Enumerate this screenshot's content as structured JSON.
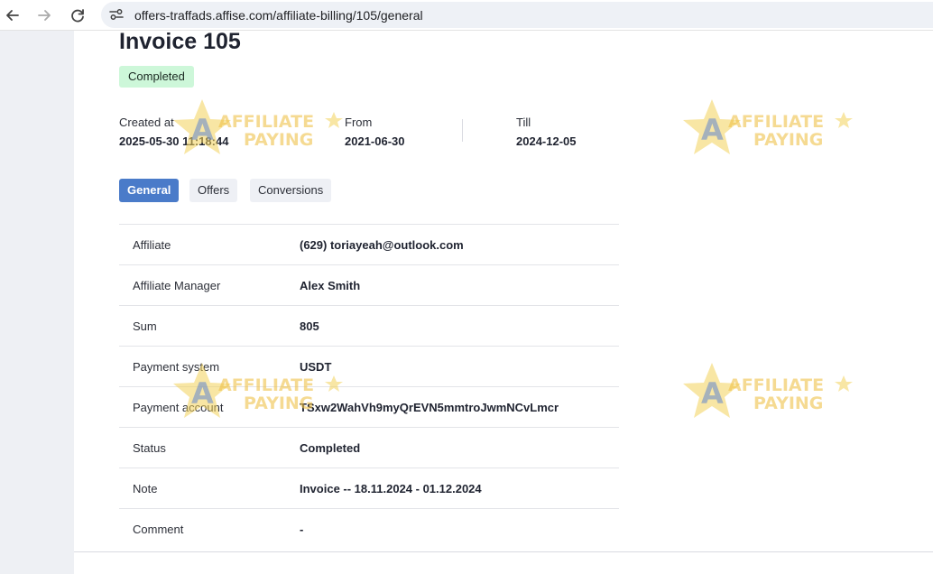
{
  "browser": {
    "url": "offers-traffads.affise.com/affiliate-billing/105/general"
  },
  "invoice": {
    "title": "Invoice 105",
    "status_badge": "Completed",
    "meta": [
      {
        "label": "Created at",
        "value": "2025-05-30 11:18:44"
      },
      {
        "label": "From",
        "value": "2021-06-30"
      },
      {
        "label": "Till",
        "value": "2024-12-05"
      }
    ]
  },
  "tabs": [
    {
      "label": "General",
      "active": true
    },
    {
      "label": "Offers",
      "active": false
    },
    {
      "label": "Conversions",
      "active": false
    }
  ],
  "details": [
    {
      "label": "Affiliate",
      "value": "(629) toriayeah@outlook.com"
    },
    {
      "label": "Affiliate Manager",
      "value": "Alex Smith"
    },
    {
      "label": "Sum",
      "value": "805"
    },
    {
      "label": "Payment system",
      "value": "USDT"
    },
    {
      "label": "Payment account",
      "value": "TSxw2WahVh9myQrEVN5mmtroJwmNCvLmcr"
    },
    {
      "label": "Status",
      "value": "Completed"
    },
    {
      "label": "Note",
      "value": "Invoice -- 18.11.2024 - 01.12.2024"
    },
    {
      "label": "Comment",
      "value": "-"
    }
  ],
  "watermark": {
    "line1": "AFFILIATE",
    "line2": "PAYING",
    "colors": {
      "star": "#f2d25a",
      "letter_a": "#6f8fcb",
      "text": "#f0c24a"
    }
  },
  "colors": {
    "accent": "#4a7bc9",
    "badge_bg": "#cdf7d9",
    "gutter": "#eef0f4"
  }
}
